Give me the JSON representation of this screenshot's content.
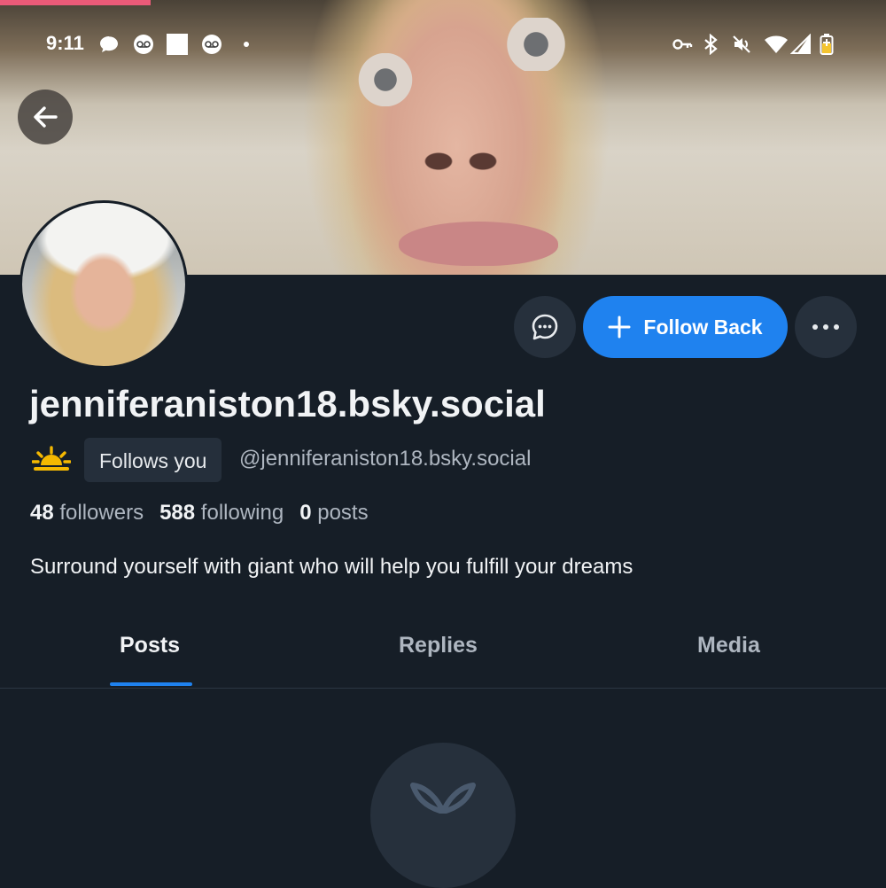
{
  "status_bar": {
    "time": "9:11",
    "icons": [
      "chat-bubble-icon",
      "voicemail-icon",
      "square-notification-icon",
      "voicemail-icon",
      "dot-icon",
      "vpn-key-icon",
      "bluetooth-icon",
      "mute-icon",
      "wifi-icon",
      "signal-icon",
      "battery-icon"
    ]
  },
  "banner": {
    "description_icon": "banner-photo"
  },
  "profile": {
    "display_name": "jenniferaniston18.bsky.social",
    "follows_you_label": "Follows you",
    "handle": "@jenniferaniston18.bsky.social",
    "followers_count": "48",
    "followers_label": "followers",
    "following_count": "588",
    "following_label": "following",
    "posts_count": "0",
    "posts_label": "posts",
    "bio": "Surround yourself with giant who will help you fulfill your dreams"
  },
  "actions": {
    "follow_back_label": "Follow Back"
  },
  "tabs": [
    {
      "label": "Posts",
      "active": true
    },
    {
      "label": "Replies",
      "active": false
    },
    {
      "label": "Media",
      "active": false
    }
  ],
  "colors": {
    "background": "#161e27",
    "accent": "#1f82ef",
    "muted_text": "#aeb6c0",
    "badge_bg": "#252f3b"
  }
}
